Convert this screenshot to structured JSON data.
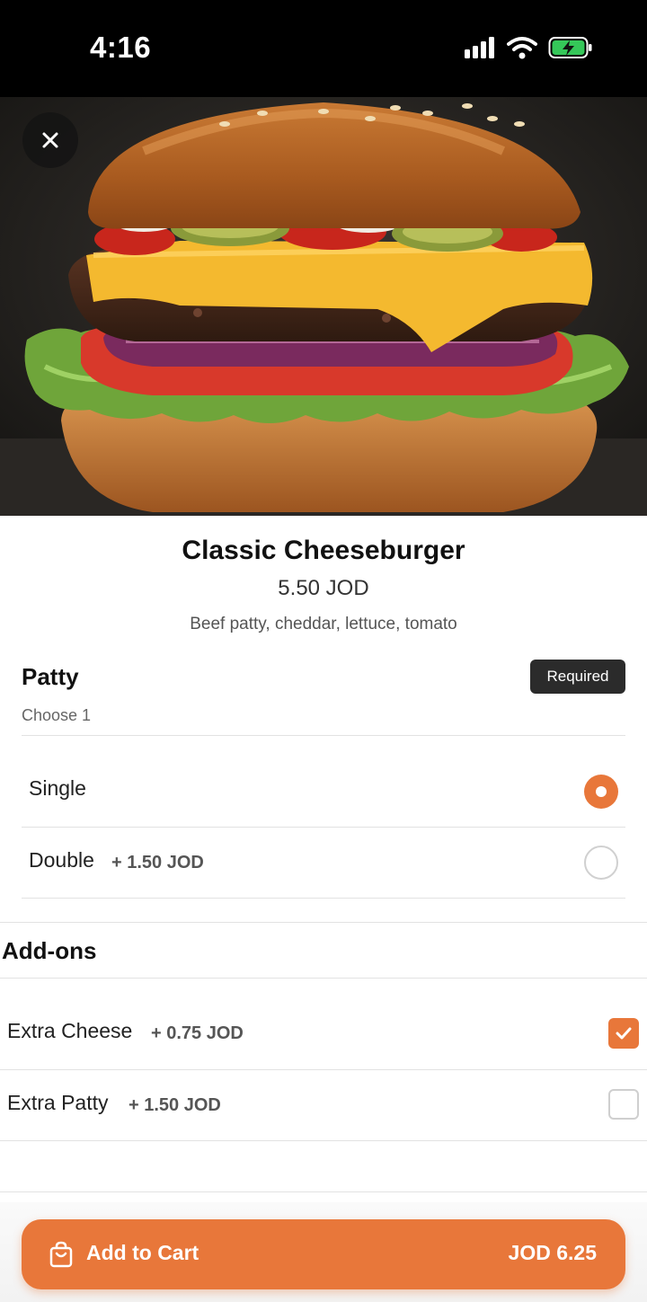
{
  "status_bar": {
    "time": "4:16"
  },
  "product": {
    "title": "Classic Cheeseburger",
    "price": "5.50 JOD",
    "description": "Beef patty, cheddar, lettuce, tomato"
  },
  "patty": {
    "title": "Patty",
    "required_label": "Required",
    "choose_label": "Choose 1",
    "options": [
      {
        "label": "Single",
        "extra": "",
        "selected": true
      },
      {
        "label": "Double",
        "extra": "+ 1.50 JOD",
        "selected": false
      }
    ]
  },
  "addons": {
    "title": "Add-ons",
    "options": [
      {
        "label": "Extra Cheese",
        "extra": "+ 0.75 JOD",
        "checked": true
      },
      {
        "label": "Extra Patty",
        "extra": "+ 1.50 JOD",
        "checked": false
      }
    ]
  },
  "cart_button": {
    "label": "Add to Cart",
    "total": "JOD 6.25",
    "icon": "shopping-bag-icon"
  },
  "colors": {
    "accent": "#e8773a",
    "badge_bg": "#2b2b2b"
  }
}
